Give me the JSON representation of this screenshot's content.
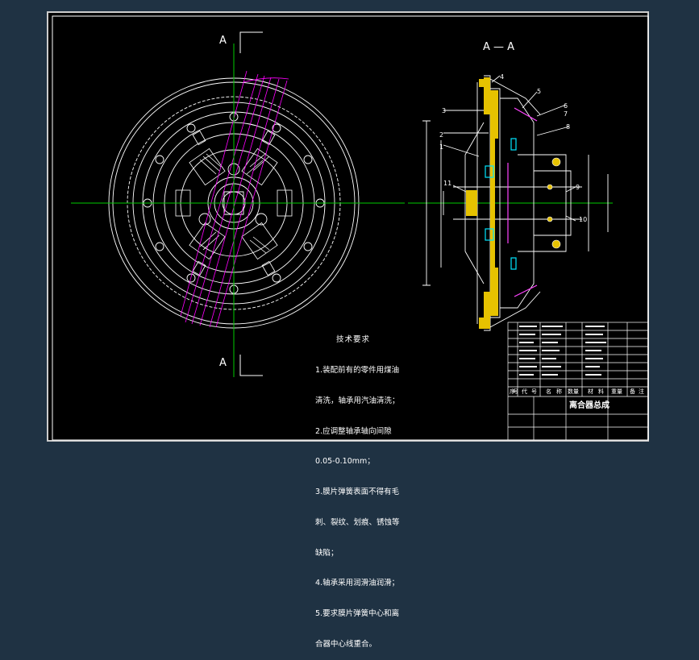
{
  "drawing": {
    "section_mark_left_top": "A",
    "section_mark_left_bottom": "A",
    "section_title": "A — A",
    "part_numbers": [
      "1",
      "2",
      "3",
      "4",
      "5",
      "6",
      "7",
      "8",
      "9",
      "10",
      "11"
    ]
  },
  "tech_requirements": {
    "title": "技术要求",
    "items": [
      "1.装配前有的零件用煤油",
      "清洗，轴承用汽油清洗；",
      "2.应调整轴承轴向间隙",
      "0.05-0.10mm；",
      "3.膜片弹簧表面不得有毛",
      "刺、裂纹、划痕、锈蚀等",
      "缺陷；",
      "4.轴承采用润滑油润滑；",
      "5.要求膜片弹簧中心和离",
      "合器中心线重合。"
    ]
  },
  "title_block": {
    "title": "离合器总成",
    "header_cols": [
      "序",
      "号",
      "代",
      "号",
      "名",
      "称",
      "数量",
      "材",
      "料",
      "重量",
      "备",
      "注"
    ]
  },
  "colors": {
    "background": "#000000",
    "outer_frame": "#1f3243",
    "centerline": "#00cc00",
    "construction": "#ff00ff",
    "yellow": "#e6c200",
    "magenta": "#ff44ff",
    "cyan": "#00e5ff",
    "line": "#ffffff"
  }
}
